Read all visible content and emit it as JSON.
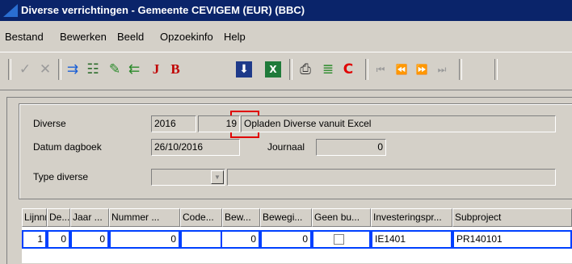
{
  "window": {
    "title": "Diverse verrichtingen - Gemeente CEVIGEM (EUR) (BBC)"
  },
  "menu": [
    "Bestand",
    "Bewerken",
    "Beeld",
    "Opzoekinfo",
    "Help"
  ],
  "toolbar": {
    "highlighted": "import-excel-button",
    "highlight_color": "#e00000"
  },
  "form": {
    "diverse_label": "Diverse",
    "diverse_year": "2016",
    "diverse_number": "19",
    "diverse_description": "Opladen Diverse vanuit Excel",
    "datum_label": "Datum dagboek",
    "datum_value": "26/10/2016",
    "journaal_label": "Journaal",
    "journaal_value": "0",
    "type_label": "Type diverse",
    "type_value": "",
    "type_description": ""
  },
  "grid": {
    "headers": [
      "Lijnnr",
      "De...",
      "Jaar ...",
      "Nummer ...",
      "Code...",
      "Bew...",
      "Bewegi...",
      "Geen bu...",
      "Investeringspr...",
      "Subproject"
    ],
    "row": {
      "lijnnr": "1",
      "de": "0",
      "jaar": "0",
      "nummer": "0",
      "code": "",
      "bew": "0",
      "bewegi": "0",
      "investeringsproject": "IE1401",
      "subproject": "PR140101"
    }
  }
}
